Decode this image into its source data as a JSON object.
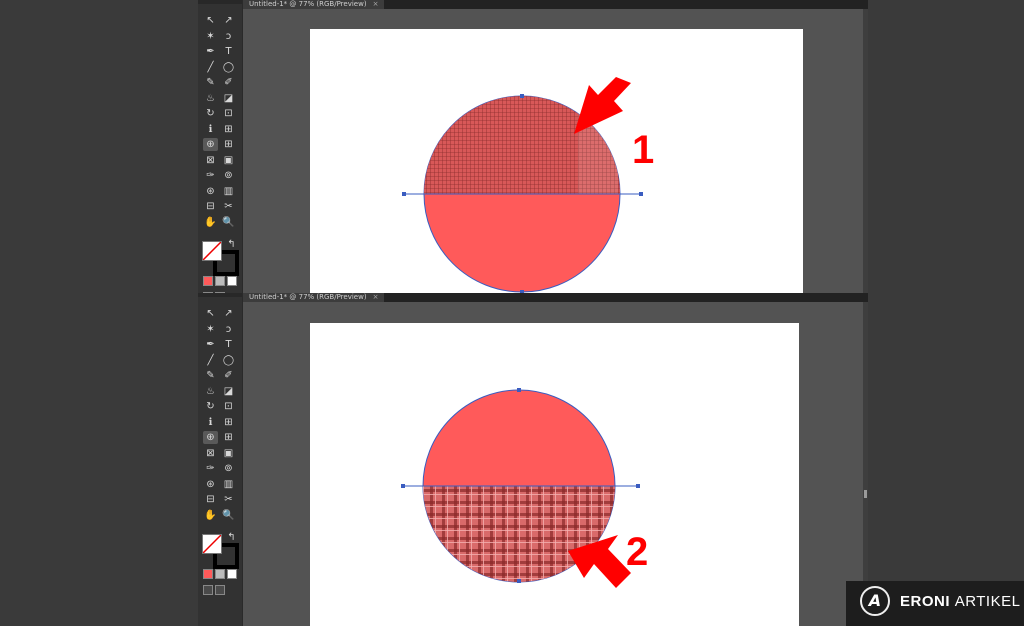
{
  "windows": [
    {
      "tab_title": "Untitled-1* @ 77% (RGB/Preview)",
      "tab_close": "×",
      "callout_number": "1"
    },
    {
      "tab_title": "Untitled-1* @ 77% (RGB/Preview)",
      "tab_close": "×",
      "callout_number": "2"
    }
  ],
  "toolbar": {
    "tools": [
      "selection",
      "direct-selection",
      "magic-wand",
      "lasso",
      "pen",
      "type",
      "line",
      "ellipse",
      "paintbrush",
      "pencil",
      "blob-brush",
      "eraser",
      "rotate",
      "scale",
      "warp",
      "free-transform",
      "shape-builder",
      "perspective-grid",
      "mesh",
      "gradient",
      "eyedropper",
      "blend",
      "symbol-sprayer",
      "column-graph",
      "artboard",
      "slice",
      "hand",
      "zoom"
    ],
    "icons": [
      "↖",
      "↗",
      "✶",
      "ↄ",
      "✒",
      "T",
      "╱",
      "◯",
      "✎",
      "✐",
      "♨",
      "◪",
      "↻",
      "⊡",
      "ℹ",
      "⊞",
      "⊕",
      "⊞",
      "⊠",
      "▣",
      "✑",
      "⊚",
      "⊛",
      "▥",
      "⊟",
      "✂",
      "✋",
      "🔍"
    ]
  },
  "colors": {
    "fill": "#ffffff",
    "stroke": "#000000",
    "shape_fill": "#ff5a5a",
    "path_stroke": "#3a5cc0",
    "arrow": "#ff0000",
    "canvas_bg": "#535353"
  },
  "branding": {
    "logo_mark": "A",
    "brand_bold": "ERONI",
    "brand_light": "ARTIKEL"
  }
}
